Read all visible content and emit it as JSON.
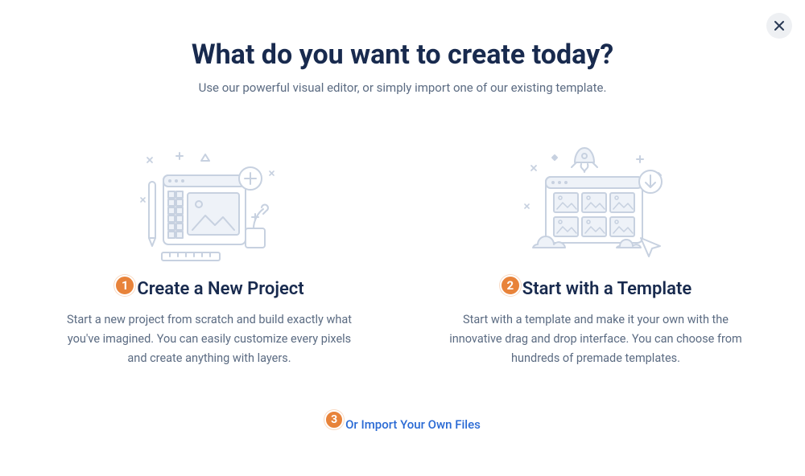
{
  "header": {
    "title": "What do you want to create today?",
    "subtitle": "Use our powerful visual editor, or simply import one of our existing template."
  },
  "options": [
    {
      "badge": "1",
      "title": "Create a New Project",
      "description": "Start a new project from scratch and build exactly what you've imagined. You can easily customize every pixels and create anything with layers."
    },
    {
      "badge": "2",
      "title": "Start with a Template",
      "description": "Start with a template and make it your own with the innovative drag and drop interface. You can choose from hundreds of premade templates."
    }
  ],
  "footer": {
    "badge": "3",
    "link_label": "Or Import Your Own Files"
  },
  "colors": {
    "accent": "#e8833a",
    "heading": "#182a4e",
    "body": "#5b6b82",
    "link": "#2a6ad4",
    "illustration_stroke": "#c7d1e0",
    "illustration_fill": "#eef2f8"
  }
}
